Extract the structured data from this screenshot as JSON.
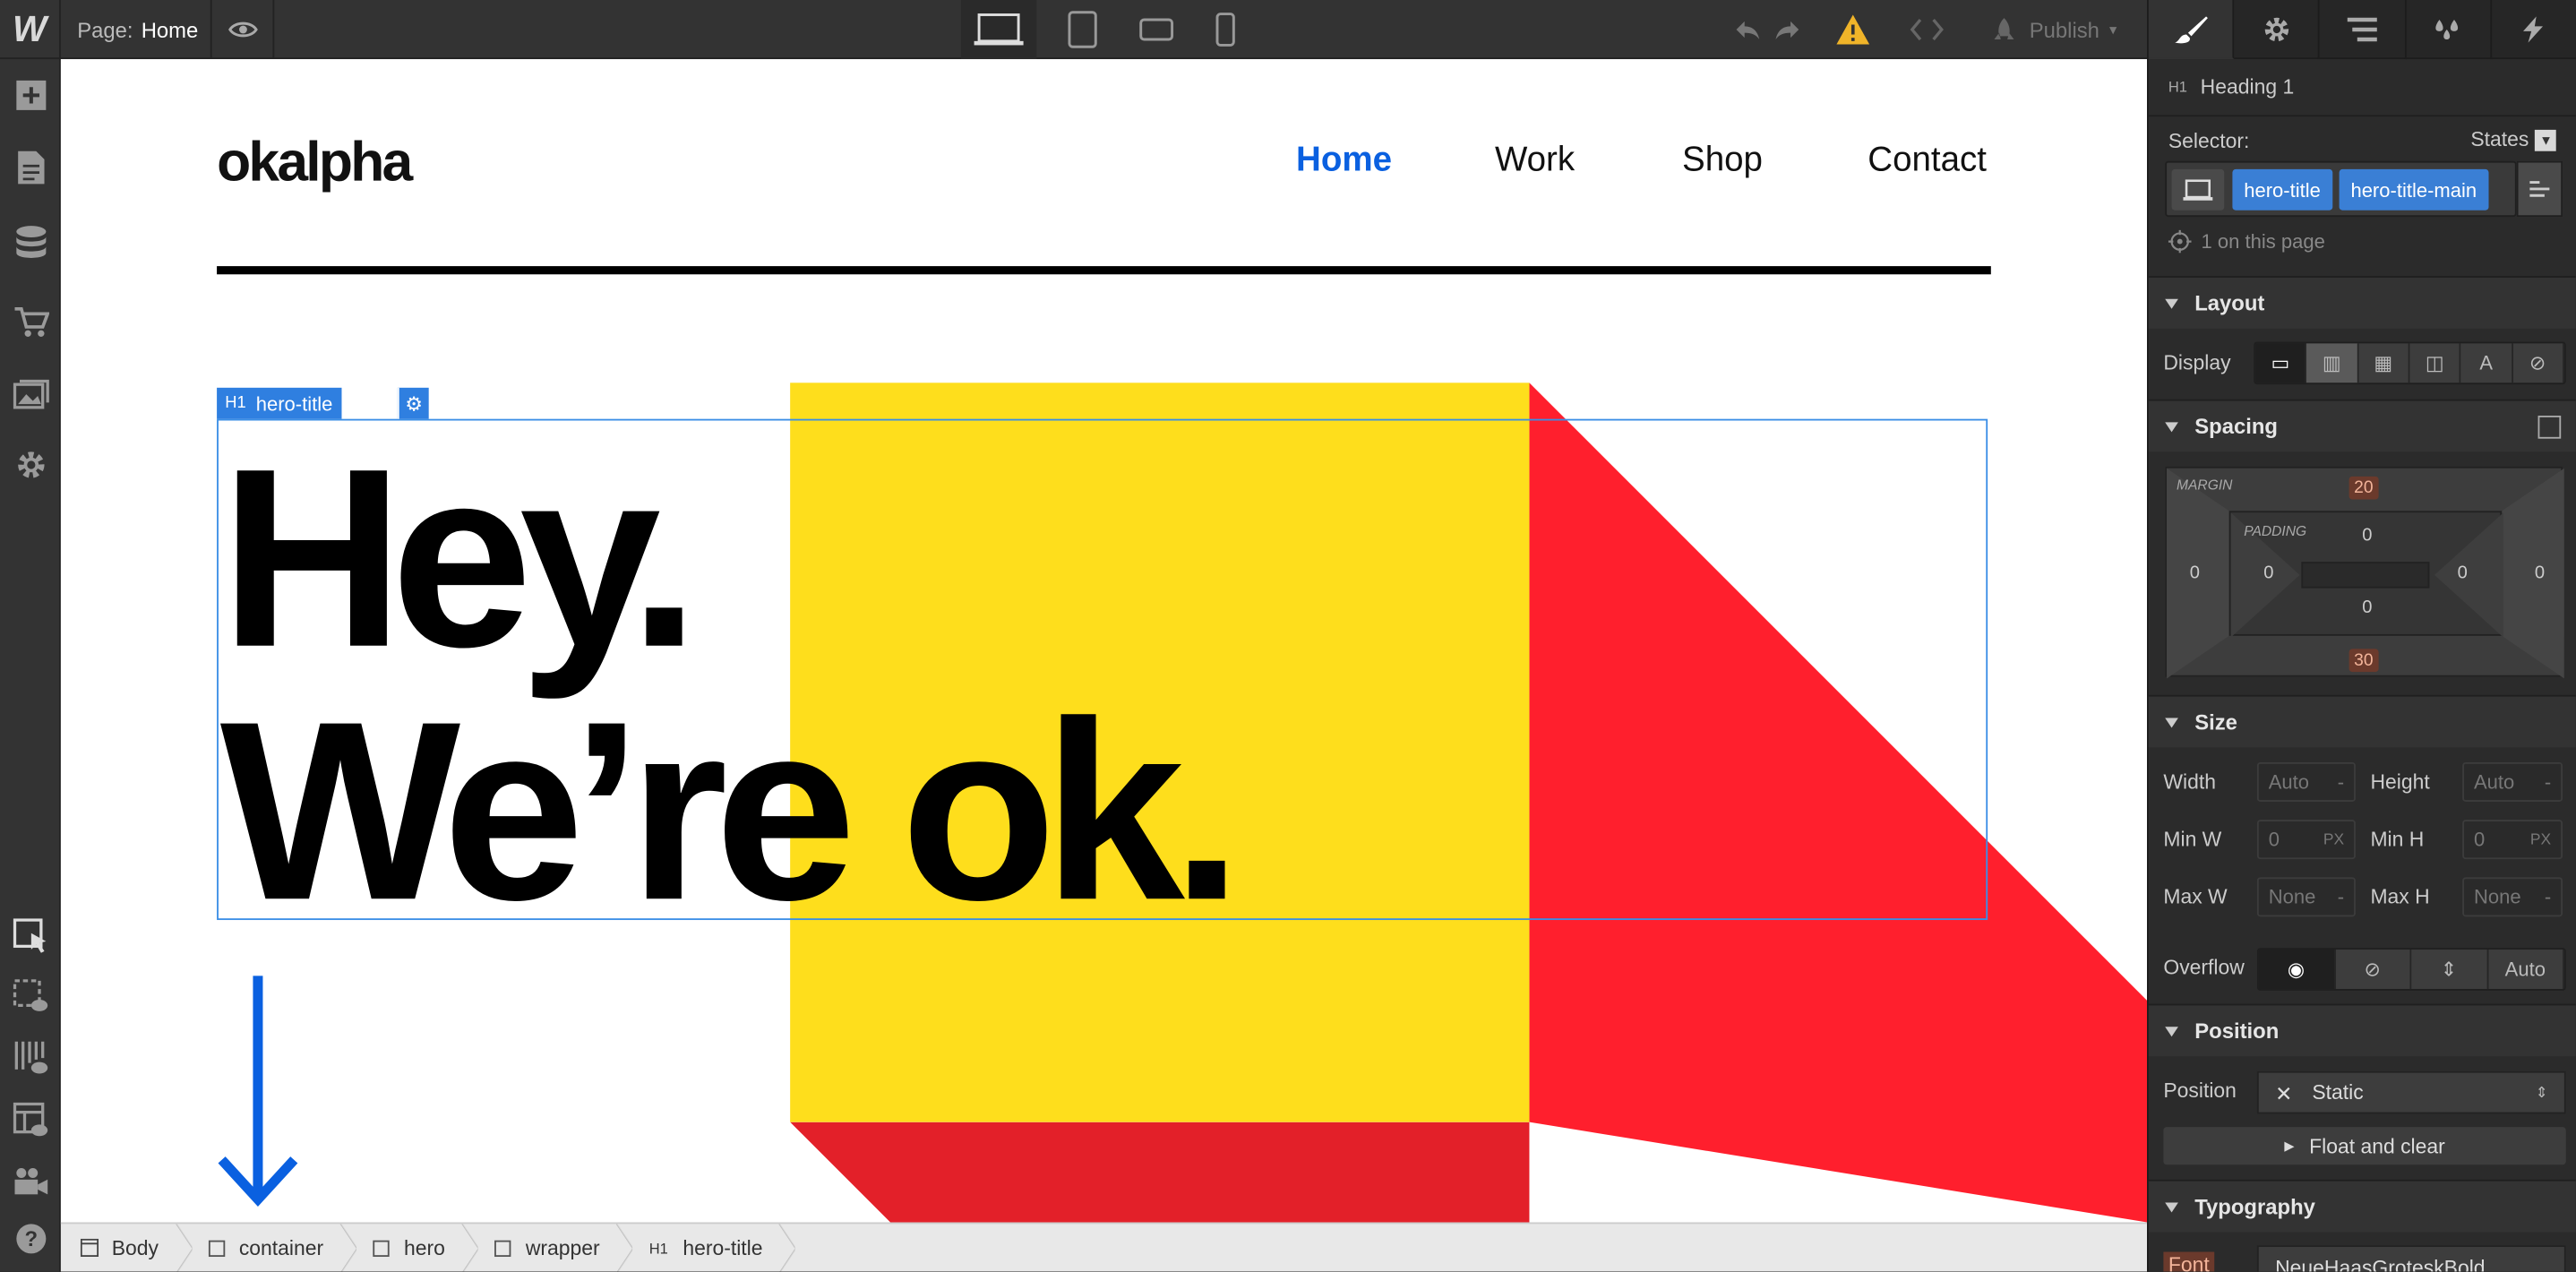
{
  "topbar": {
    "logo": "W",
    "page_prefix": "Page:",
    "page_name": "Home",
    "publish_label": "Publish"
  },
  "site": {
    "brand": "okalpha",
    "nav": [
      "Home",
      "Work",
      "Shop",
      "Contact"
    ],
    "nav_active_color": "#0a60e0",
    "hero_line1": "Hey.",
    "hero_line2": "We’re ok.",
    "colors": {
      "yellow": "#fede1c",
      "red": "#ff1f2d",
      "arrow": "#0a60e0"
    }
  },
  "selection": {
    "tag": "H1",
    "label": "hero-title"
  },
  "breadcrumb": [
    {
      "kind": "body",
      "label": "Body"
    },
    {
      "kind": "box",
      "label": "container"
    },
    {
      "kind": "box",
      "label": "hero"
    },
    {
      "kind": "box",
      "label": "wrapper"
    },
    {
      "kind": "h1",
      "label": "hero-title"
    }
  ],
  "panel": {
    "element_tag": "H1",
    "element_name": "Heading 1",
    "selector_label": "Selector:",
    "states_label": "States",
    "classes": [
      "hero-title",
      "hero-title-main"
    ],
    "on_page": "1 on this page",
    "layout": {
      "title": "Layout",
      "display_label": "Display"
    },
    "spacing": {
      "title": "Spacing",
      "margin_label": "MARGIN",
      "padding_label": "PADDING",
      "margin": {
        "top": "20",
        "right": "0",
        "bottom": "30",
        "left": "0"
      },
      "padding": {
        "top": "0",
        "right": "0",
        "bottom": "0",
        "left": "0"
      }
    },
    "size": {
      "title": "Size",
      "width_label": "Width",
      "width_value": "Auto",
      "height_label": "Height",
      "height_value": "Auto",
      "minw_label": "Min W",
      "minw_value": "0",
      "minw_unit": "PX",
      "minh_label": "Min H",
      "minh_value": "0",
      "minh_unit": "PX",
      "maxw_label": "Max W",
      "maxw_value": "None",
      "maxh_label": "Max H",
      "maxh_value": "None",
      "dash": "-",
      "overflow_label": "Overflow",
      "overflow_auto": "Auto"
    },
    "position": {
      "title": "Position",
      "label": "Position",
      "value": "Static",
      "float_label": "Float and clear"
    },
    "typography": {
      "title": "Typography",
      "font_label": "Font",
      "font_value": "NeueHaasGroteskBold"
    }
  }
}
